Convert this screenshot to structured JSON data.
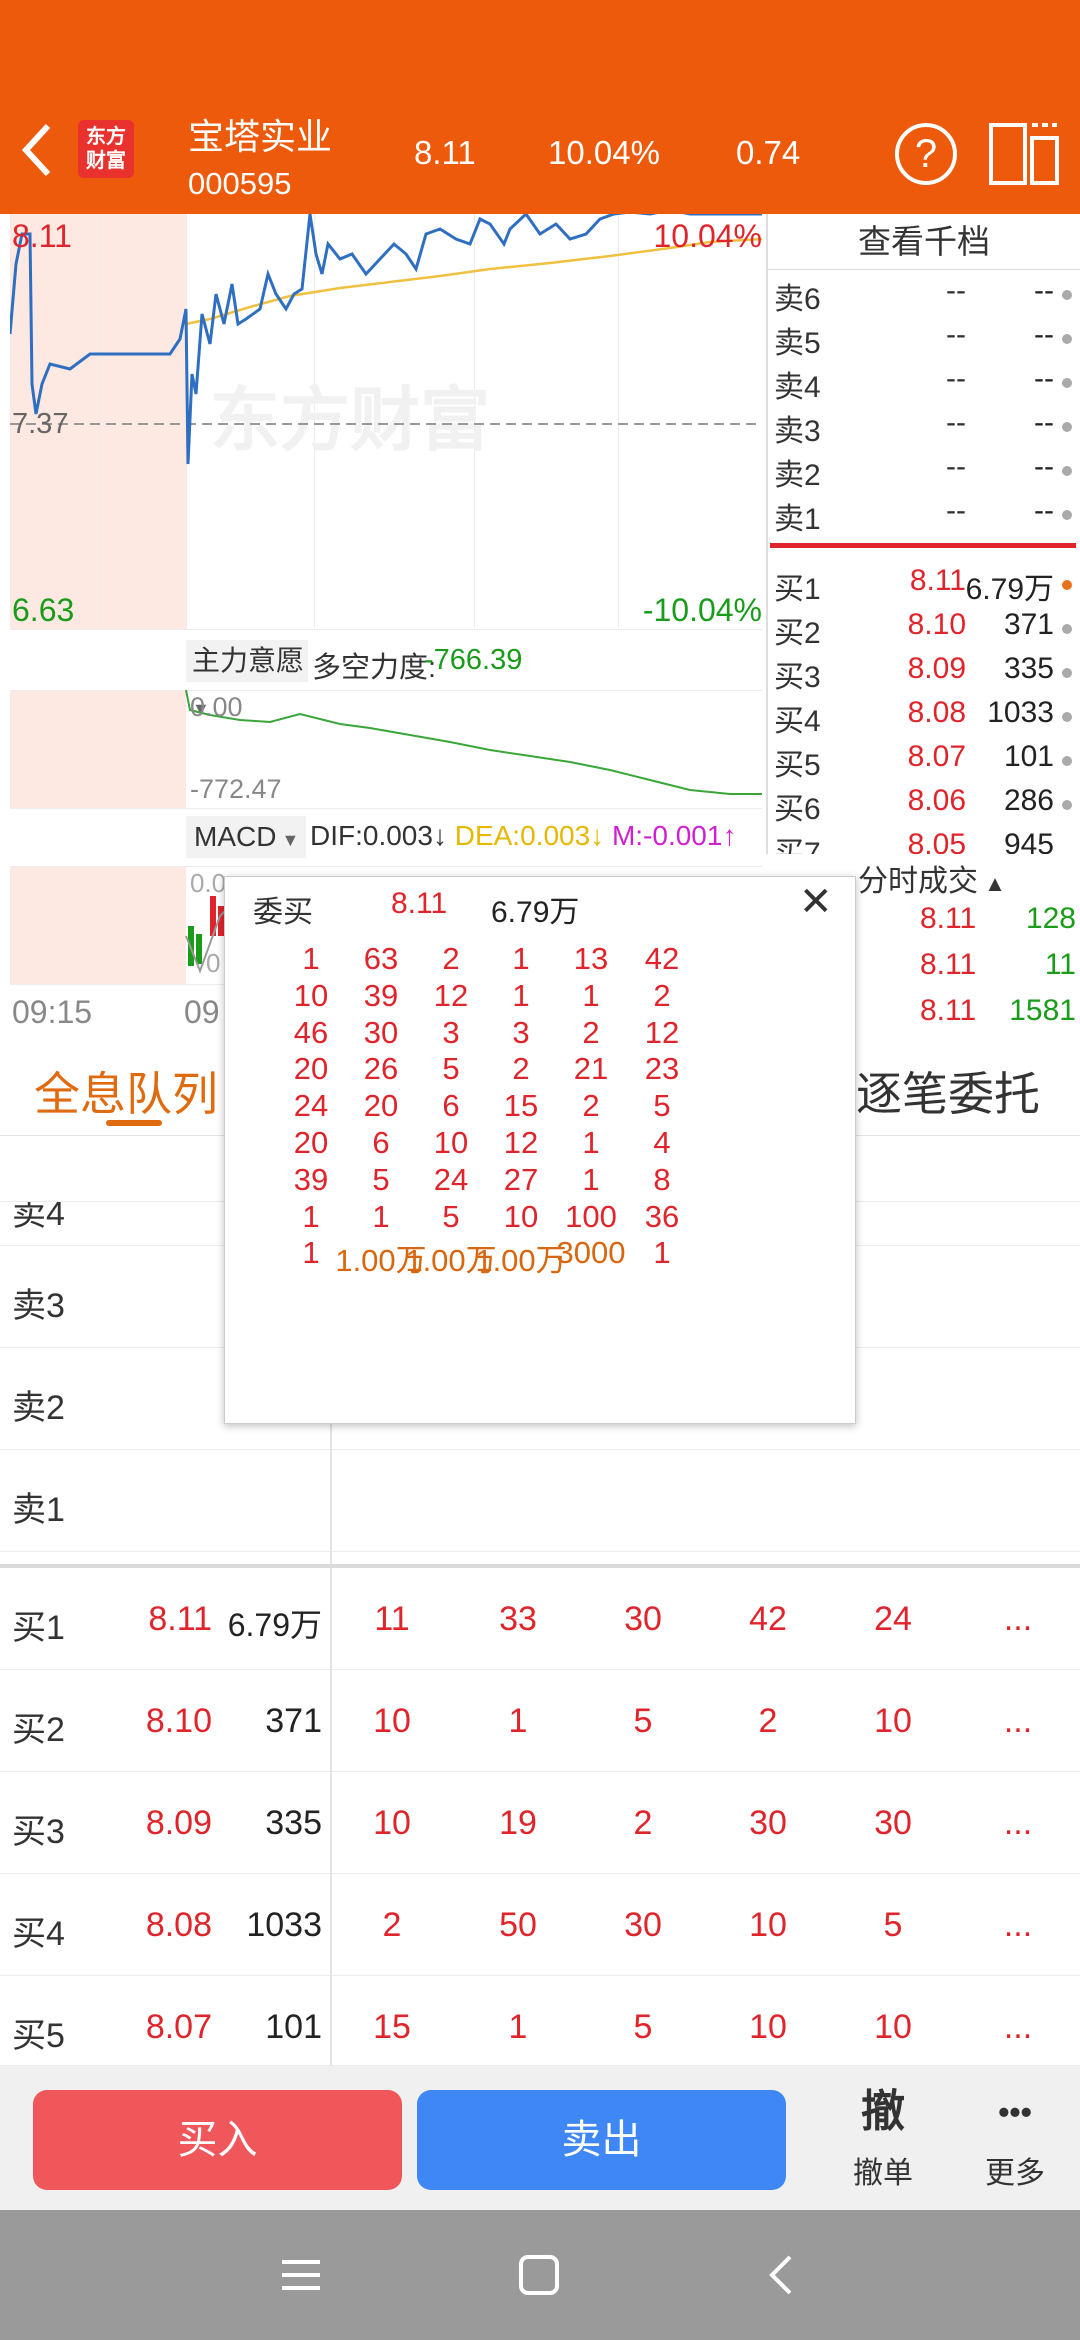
{
  "header": {
    "logo_line1": "东方",
    "logo_line2": "财富",
    "stock_name": "宝塔实业",
    "stock_code": "000595",
    "price": "8.11",
    "change_pct": "10.04%",
    "change": "0.74",
    "help_label": "?"
  },
  "chart": {
    "high": "8.11",
    "low": "6.63",
    "mid": "7.37",
    "high_pct": "10.04%",
    "low_pct": "-10.04%",
    "watermark": "东方财富",
    "main_intent_label": "主力意愿",
    "force_label": "多空力度:",
    "force_value": "-766.39",
    "sub_high": "0.00",
    "sub_low": "-772.47",
    "macd_label": "MACD",
    "dif": "DIF:0.003",
    "dif_arrow": "↓",
    "dea": "DEA:0.003",
    "dea_arrow": "↓",
    "m": "M:-0.001",
    "m_arrow": "↑",
    "macd_tick1": "0.0",
    "macd_tick2": "0",
    "time_start": "09:15",
    "time_mid": "09",
    "colors": {
      "price_line": "#2f6fc1",
      "avg_line": "#f0c040",
      "force_line": "#3aa63a",
      "shade": "#fde9e2"
    }
  },
  "order_book": {
    "title": "查看千档",
    "asks": [
      {
        "label": "卖6",
        "price": "--",
        "vol": "--"
      },
      {
        "label": "卖5",
        "price": "--",
        "vol": "--"
      },
      {
        "label": "卖4",
        "price": "--",
        "vol": "--"
      },
      {
        "label": "卖3",
        "price": "--",
        "vol": "--"
      },
      {
        "label": "卖2",
        "price": "--",
        "vol": "--"
      },
      {
        "label": "卖1",
        "price": "--",
        "vol": "--"
      }
    ],
    "bids": [
      {
        "label": "买1",
        "price": "8.11",
        "vol": "6.79万"
      },
      {
        "label": "买2",
        "price": "8.10",
        "vol": "371"
      },
      {
        "label": "买3",
        "price": "8.09",
        "vol": "335"
      },
      {
        "label": "买4",
        "price": "8.08",
        "vol": "1033"
      },
      {
        "label": "买5",
        "price": "8.07",
        "vol": "101"
      },
      {
        "label": "买6",
        "price": "8.06",
        "vol": "286"
      },
      {
        "label": "买7",
        "price": "8.05",
        "vol": "945"
      }
    ]
  },
  "trades": {
    "title": "分时成交",
    "rows": [
      {
        "price": "8.11",
        "vol": "128"
      },
      {
        "price": "8.11",
        "vol": "11"
      },
      {
        "price": "8.11",
        "vol": "1581"
      }
    ]
  },
  "tabs": {
    "left": "全息队列",
    "right": "逐笔委托"
  },
  "queue": {
    "asks": [
      {
        "label": "卖4"
      },
      {
        "label": "卖3"
      },
      {
        "label": "卖2"
      },
      {
        "label": "卖1"
      }
    ],
    "bids": [
      {
        "label": "买1",
        "price": "8.11",
        "vol": "6.79万",
        "orders": [
          "11",
          "33",
          "30",
          "42",
          "24",
          "..."
        ]
      },
      {
        "label": "买2",
        "price": "8.10",
        "vol": "371",
        "orders": [
          "10",
          "1",
          "5",
          "2",
          "10",
          "..."
        ]
      },
      {
        "label": "买3",
        "price": "8.09",
        "vol": "335",
        "orders": [
          "10",
          "19",
          "2",
          "30",
          "30",
          "..."
        ]
      },
      {
        "label": "买4",
        "price": "8.08",
        "vol": "1033",
        "orders": [
          "2",
          "50",
          "30",
          "10",
          "5",
          "..."
        ]
      },
      {
        "label": "买5",
        "price": "8.07",
        "vol": "101",
        "orders": [
          "15",
          "1",
          "5",
          "10",
          "10",
          "..."
        ]
      }
    ]
  },
  "popup": {
    "title": "委买",
    "price": "8.11",
    "vol": "6.79万",
    "close_label": "✕",
    "rows": [
      [
        "1",
        "63",
        "2",
        "1",
        "13",
        "42"
      ],
      [
        "10",
        "39",
        "12",
        "1",
        "1",
        "2"
      ],
      [
        "46",
        "30",
        "3",
        "3",
        "2",
        "12"
      ],
      [
        "20",
        "26",
        "5",
        "2",
        "21",
        "23"
      ],
      [
        "24",
        "20",
        "6",
        "15",
        "2",
        "5"
      ],
      [
        "20",
        "6",
        "10",
        "12",
        "1",
        "4"
      ],
      [
        "39",
        "5",
        "24",
        "27",
        "1",
        "8"
      ],
      [
        "1",
        "1",
        "5",
        "10",
        "100",
        "36"
      ],
      [
        "1",
        "1.00万",
        "1.00万",
        "1.00万",
        "3000",
        "1"
      ]
    ]
  },
  "bottom": {
    "buy": "买入",
    "sell": "卖出",
    "cancel_icon": "撤",
    "cancel": "撤单",
    "more_icon": "•••",
    "more": "更多"
  }
}
